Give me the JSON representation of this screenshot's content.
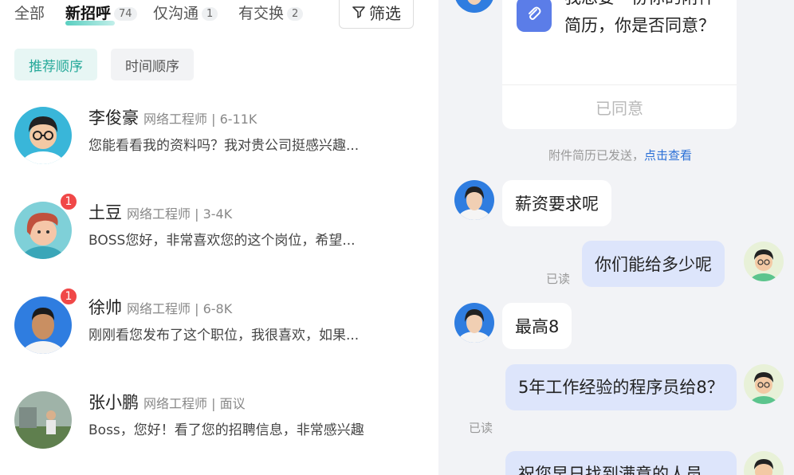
{
  "tabs": [
    {
      "label": "全部",
      "count": ""
    },
    {
      "label": "新招呼",
      "count": "74"
    },
    {
      "label": "仅沟通",
      "count": "1"
    },
    {
      "label": "有交换",
      "count": "2"
    }
  ],
  "filter_label": "筛选",
  "sort": {
    "recommended": "推荐顺序",
    "time": "时间顺序"
  },
  "conversations": [
    {
      "name": "李俊豪",
      "role": "网络工程师 | 6-11K",
      "preview": "您能看看我的资料吗？我对贵公司挺感兴趣...",
      "badge": ""
    },
    {
      "name": "土豆",
      "role": "网络工程师 | 3-4K",
      "preview": "BOSS您好，非常喜欢您的这个岗位，希望...",
      "badge": "1"
    },
    {
      "name": "徐帅",
      "role": "网络工程师 | 6-8K",
      "preview": "刚刚看您发布了这个职位，我很喜欢，如果...",
      "badge": "1"
    },
    {
      "name": "张小鹏",
      "role": "网络工程师 | 面议",
      "preview": "Boss，您好！看了您的招聘信息，非常感兴趣",
      "badge": ""
    }
  ],
  "chat": {
    "resume_request": "我想要一份你的附件简历，你是否同意？",
    "resume_action": "已同意",
    "system_note": "附件简历已发送，",
    "system_link": "点击查看",
    "messages": [
      {
        "from": "them",
        "text": "薪资要求呢"
      },
      {
        "from": "me",
        "text": "你们能给多少呢",
        "status": "已读"
      },
      {
        "from": "them",
        "text": "最高8"
      },
      {
        "from": "me",
        "text": "5年工作经验的程序员给8？",
        "status": "已读"
      },
      {
        "from": "me",
        "text": "祝您早日找到满意的人员"
      }
    ]
  },
  "colors": {
    "accent": "#26a99a",
    "badge": "#f04848",
    "out_bubble": "#dde5fb",
    "link": "#2a6fd6"
  }
}
